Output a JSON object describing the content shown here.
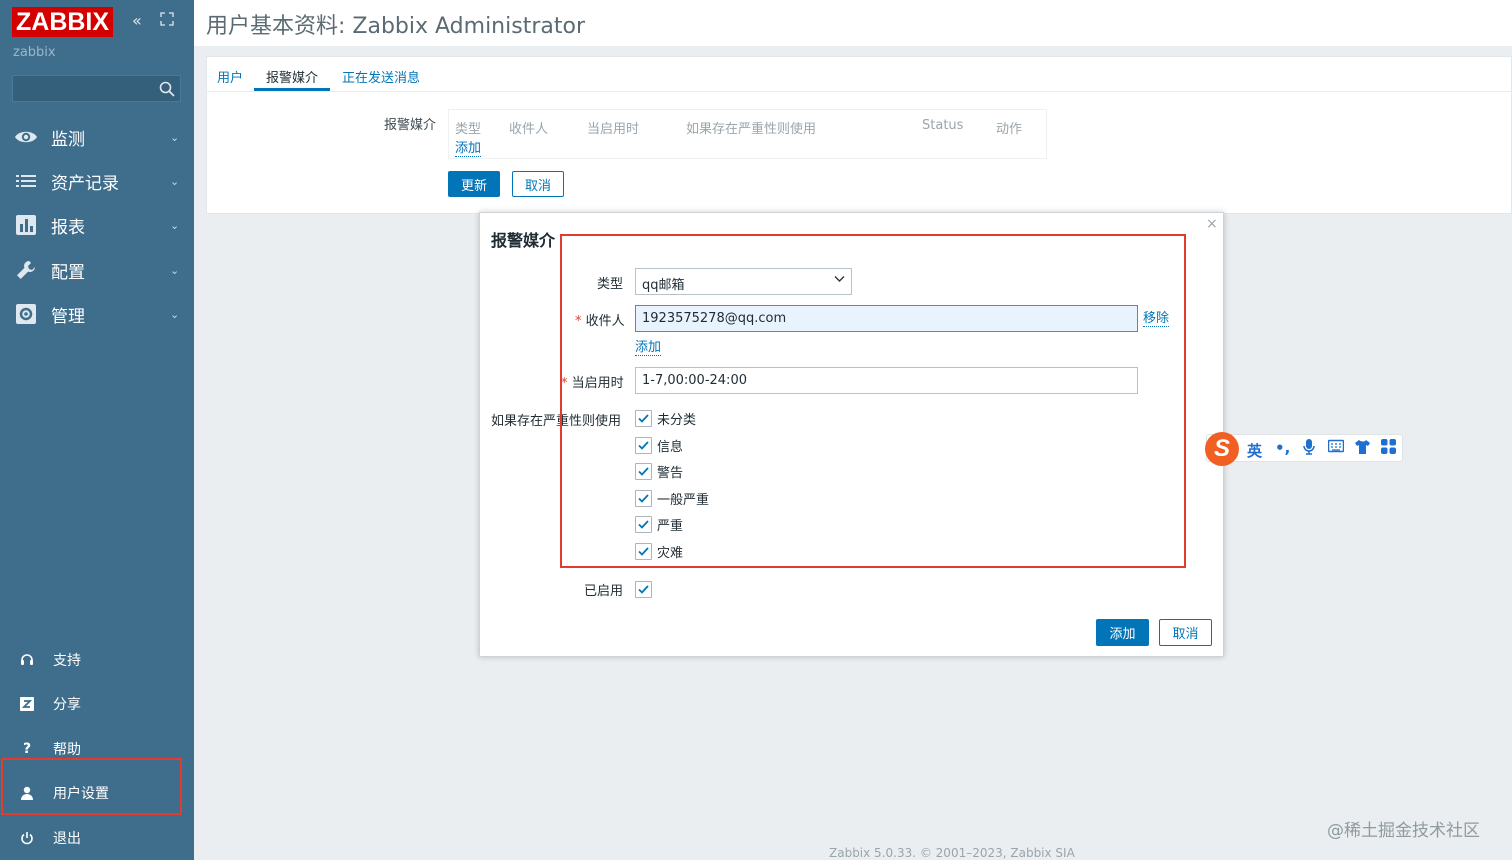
{
  "sidebar": {
    "logo": "ZABBIX",
    "server_name": "zabbix",
    "collapse_icon": "double-chevron-left-icon",
    "kiosk_icon": "fullscreen-icon",
    "menu": [
      {
        "label": "监测",
        "icon": "eye-icon"
      },
      {
        "label": "资产记录",
        "icon": "list-icon"
      },
      {
        "label": "报表",
        "icon": "bar-chart-icon"
      },
      {
        "label": "配置",
        "icon": "wrench-icon"
      },
      {
        "label": "管理",
        "icon": "gear-icon"
      }
    ],
    "bottom": [
      {
        "label": "支持",
        "icon": "headset-icon"
      },
      {
        "label": "分享",
        "icon": "share-z-icon"
      },
      {
        "label": "帮助",
        "icon": "help-icon"
      },
      {
        "label": "用户设置",
        "icon": "user-icon"
      },
      {
        "label": "退出",
        "icon": "power-icon"
      }
    ]
  },
  "page": {
    "title": "用户基本资料: Zabbix Administrator",
    "tabs": [
      "用户",
      "报警媒介",
      "正在发送消息"
    ],
    "media_label": "报警媒介",
    "media_headers": [
      "类型",
      "收件人",
      "当启用时",
      "如果存在严重性则使用",
      "Status",
      "动作"
    ],
    "media_add": "添加",
    "update_button": "更新",
    "cancel_button": "取消"
  },
  "dialog": {
    "title": "报警媒介",
    "close": "×",
    "type_label": "类型",
    "type_value": "qq邮箱",
    "recipient_label": "收件人",
    "recipient_value": "1923575278@qq.com",
    "remove_link": "移除",
    "add_link": "添加",
    "when_label": "当启用时",
    "when_value": "1-7,00:00-24:00",
    "severity_label": "如果存在严重性则使用",
    "severities": [
      "未分类",
      "信息",
      "警告",
      "一般严重",
      "严重",
      "灾难"
    ],
    "enabled_label": "已启用",
    "add_button": "添加",
    "cancel_button": "取消",
    "accent": "#0275b8"
  },
  "ime": {
    "logo": "S",
    "mode": "英",
    "punct": "•,"
  },
  "footer": "Zabbix 5.0.33. © 2001–2023, Zabbix SIA",
  "watermark": "@稀土掘金技术社区"
}
